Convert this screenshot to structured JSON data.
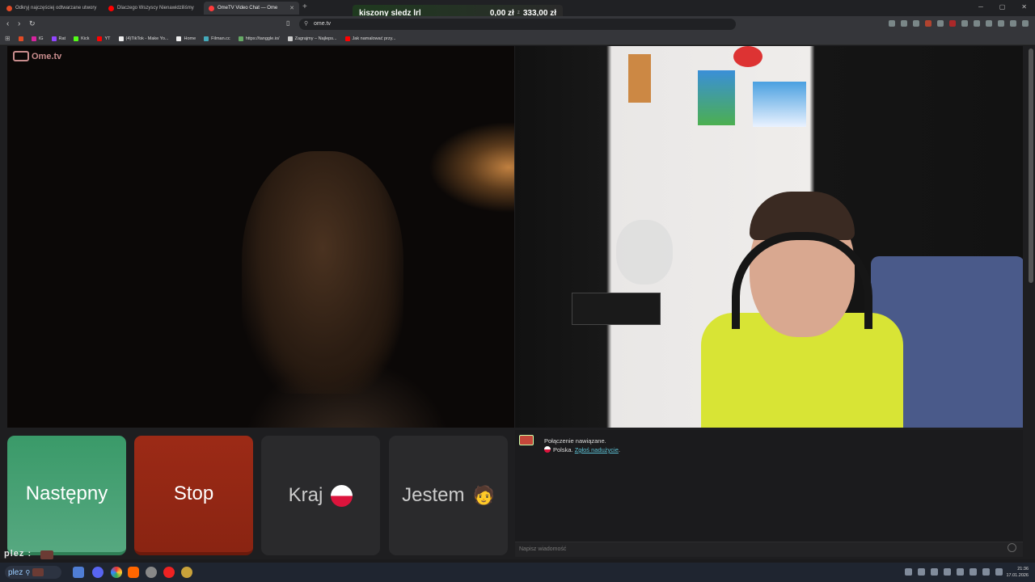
{
  "tabs": [
    {
      "label": "Odkryj najczęściej odtwarzane utwory",
      "active": false,
      "color": "#e24b26"
    },
    {
      "label": "Dlaczego Wszyscy Nienawidziliśmy",
      "active": false,
      "color": "#ff0000"
    },
    {
      "label": "OmeTV Video Chat — Ome",
      "active": true,
      "color": "#ff3b3b"
    }
  ],
  "donation": {
    "name": "kiszony sledz lrl",
    "current": "0,00 zł",
    "separator": "z",
    "goal": "333,00 zł"
  },
  "address": {
    "url": "ome.tv"
  },
  "bookmarks": [
    {
      "label": "IG",
      "icon": "instagram-icon",
      "color": "#d6249f"
    },
    {
      "label": "Rat",
      "icon": "twitch-icon",
      "color": "#9146ff"
    },
    {
      "label": "Kick",
      "icon": "kick-icon",
      "color": "#53fc18"
    },
    {
      "label": "YT",
      "icon": "youtube-icon",
      "color": "#ff0000"
    },
    {
      "label": "(4)TikTok - Make Yo...",
      "icon": "tiktok-icon",
      "color": "#eeeeee"
    },
    {
      "label": "Home",
      "icon": "x-icon",
      "color": "#eeeeee"
    },
    {
      "label": "Filman.cc",
      "icon": "filman-icon",
      "color": "#4ab"
    },
    {
      "label": "https://tanggle.io/",
      "icon": "puzzle-icon",
      "color": "#6a6"
    },
    {
      "label": "Zagrajmy – Najleps...",
      "icon": "game-icon",
      "color": "#ccc"
    },
    {
      "label": "Jak namalować przy...",
      "icon": "youtube-icon",
      "color": "#ff0000"
    }
  ],
  "site": {
    "logo": "Ome.tv"
  },
  "controls": {
    "next": "Następny",
    "stop": "Stop",
    "country": "Kraj",
    "iam": "Jestem",
    "iam_emoji": "🧑"
  },
  "chat": {
    "status": "Połączenie nawiązane.",
    "country": "Polska.",
    "report": "Zgłoś nadużycie",
    "report_suffix": ".",
    "placeholder": "Napisz wiadomość"
  },
  "overlay": {
    "text": "plez :"
  },
  "taskbar": {
    "search_text": "plez",
    "time": "21:36",
    "date": "17.01.2026"
  }
}
